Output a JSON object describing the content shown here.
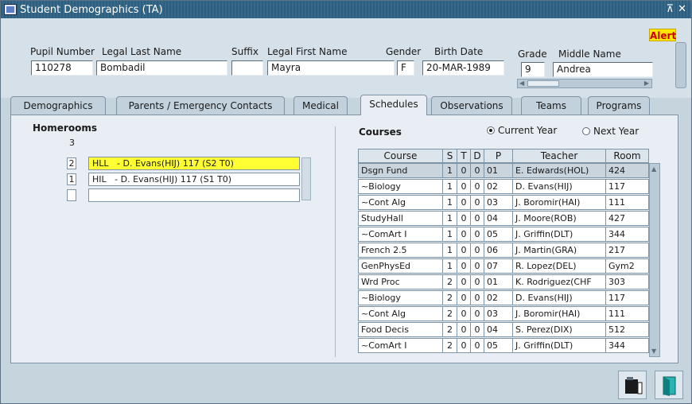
{
  "window": {
    "title": "Student Demographics (TA)",
    "restore_glyph": "⊼",
    "close_glyph": "✕"
  },
  "alert": "Alert",
  "header": {
    "pupil_number_label": "Pupil Number",
    "pupil_number": "110278",
    "last_name_label": "Legal Last Name",
    "last_name": "Bombadil",
    "suffix_label": "Suffix",
    "suffix": "",
    "first_name_label": "Legal First Name",
    "first_name": "Mayra",
    "gender_label": "Gender",
    "gender": "F",
    "birth_date_label": "Birth Date",
    "birth_date": "20-MAR-1989",
    "grade_label": "Grade",
    "grade": "9",
    "middle_name_label": "Middle Name",
    "middle_name": "Andrea"
  },
  "tabs": [
    {
      "label": "Demographics"
    },
    {
      "label": "Parents / Emergency Contacts"
    },
    {
      "label": "Medical"
    },
    {
      "label": "Schedules"
    },
    {
      "label": "Observations"
    },
    {
      "label": "Teams"
    },
    {
      "label": "Programs"
    }
  ],
  "homerooms": {
    "title": "Homerooms",
    "header_digit": "3",
    "rows": [
      {
        "num": "2",
        "text": "HLL   - D. Evans(HIJ) 117 (S2 T0)"
      },
      {
        "num": "1",
        "text": "HIL   - D. Evans(HIJ) 117 (S1 T0)"
      },
      {
        "num": "",
        "text": ""
      }
    ]
  },
  "courses": {
    "title": "Courses",
    "current_year": "Current Year",
    "next_year": "Next Year",
    "headers": [
      "Course",
      "S",
      "T",
      "D",
      "P",
      "Teacher",
      "Room"
    ],
    "rows": [
      [
        "Dsgn Fund",
        "1",
        "0",
        "0",
        "01",
        "E. Edwards(HOL)",
        "424"
      ],
      [
        "~Biology",
        "1",
        "0",
        "0",
        "02",
        "D. Evans(HIJ)",
        "117"
      ],
      [
        "~Cont Alg",
        "1",
        "0",
        "0",
        "03",
        "J. Boromir(HAI)",
        "111"
      ],
      [
        "StudyHall",
        "1",
        "0",
        "0",
        "04",
        "J. Moore(ROB)",
        "427"
      ],
      [
        "~ComArt I",
        "1",
        "0",
        "0",
        "05",
        "J. Griffin(DLT)",
        "344"
      ],
      [
        "French 2.5",
        "1",
        "0",
        "0",
        "06",
        "J. Martin(GRA)",
        "217"
      ],
      [
        "GenPhysEd",
        "1",
        "0",
        "0",
        "07",
        "R. Lopez(DEL)",
        "Gym2"
      ],
      [
        "Wrd Proc",
        "2",
        "0",
        "0",
        "01",
        "K. Rodriguez(CHF",
        "303"
      ],
      [
        "~Biology",
        "2",
        "0",
        "0",
        "02",
        "D. Evans(HIJ)",
        "117"
      ],
      [
        "~Cont Alg",
        "2",
        "0",
        "0",
        "03",
        "J. Boromir(HAI)",
        "111"
      ],
      [
        "Food Decis",
        "2",
        "0",
        "0",
        "04",
        "S. Perez(DIX)",
        "512"
      ],
      [
        "~ComArt I",
        "2",
        "0",
        "0",
        "05",
        "J. Griffin(DLT)",
        "344"
      ]
    ]
  },
  "colors": {
    "title_bar": "#2f5d7c",
    "alert_bg": "#ffe600",
    "alert_text": "#cc0000",
    "selected_homeroom": "#ffff33"
  },
  "icons": [
    "app-icon",
    "restore-icon",
    "close-icon",
    "film-clip-icon",
    "exit-door-icon"
  ]
}
